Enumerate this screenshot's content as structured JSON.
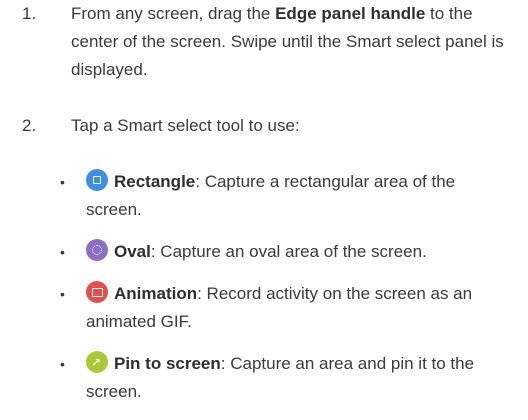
{
  "steps": [
    {
      "number": "1.",
      "text_before": "From any screen, drag the ",
      "bold": "Edge panel handle",
      "text_after": " to the center of the screen. Swipe until the Smart select panel is displayed."
    },
    {
      "number": "2.",
      "text": "Tap a Smart select tool to use:"
    }
  ],
  "bullet_marker": "•",
  "tools": [
    {
      "icon": "rectangle-select-icon",
      "color": "#3f8fe0",
      "name": "Rectangle",
      "description": ": Capture a rectangular area of the screen."
    },
    {
      "icon": "oval-select-icon",
      "color": "#8a6fc4",
      "name": "Oval",
      "description": ": Capture an oval area of the screen."
    },
    {
      "icon": "animation-icon",
      "color": "#e0514d",
      "name": "Animation",
      "description": ": Record activity on the screen as an animated GIF."
    },
    {
      "icon": "pin-to-screen-icon",
      "color": "#a8c93a",
      "name": "Pin to screen",
      "description": ": Capture an area and pin it to the screen."
    }
  ]
}
